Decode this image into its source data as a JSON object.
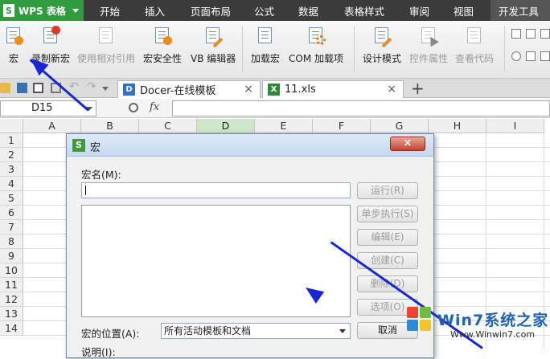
{
  "app": {
    "name": "WPS 表格",
    "logo": "S"
  },
  "menu": [
    {
      "label": "开始"
    },
    {
      "label": "插入"
    },
    {
      "label": "页面布局"
    },
    {
      "label": "公式"
    },
    {
      "label": "数据"
    },
    {
      "label": "表格样式"
    },
    {
      "label": "审阅"
    },
    {
      "label": "视图"
    },
    {
      "label": "开发工具",
      "active": true
    }
  ],
  "ribbon": [
    {
      "label": "宏",
      "icon": "macro-icon",
      "enabled": true
    },
    {
      "label": "录制新宏",
      "icon": "record-macro-icon",
      "enabled": true
    },
    {
      "label": "使用相对引用",
      "icon": "relative-reference-icon",
      "enabled": false
    },
    {
      "label": "宏安全性",
      "icon": "macro-security-icon",
      "enabled": true
    },
    {
      "label": "VB 编辑器",
      "icon": "vb-editor-icon",
      "enabled": true
    },
    {
      "label": "加载宏",
      "icon": "load-macro-icon",
      "enabled": true
    },
    {
      "label": "COM 加载项",
      "icon": "com-addin-icon",
      "enabled": true
    },
    {
      "label": "设计模式",
      "icon": "design-mode-icon",
      "enabled": true
    },
    {
      "label": "控件属性",
      "icon": "control-properties-icon",
      "enabled": false
    },
    {
      "label": "查看代码",
      "icon": "view-code-icon",
      "enabled": false
    }
  ],
  "tabs": [
    {
      "label": "Docer-在线模板",
      "icon": "docer-icon",
      "icon_text": "D",
      "close": "×"
    },
    {
      "label": "11.xls",
      "icon": "xls-file-icon",
      "icon_text": "X",
      "close": "×"
    }
  ],
  "new_tab": "+",
  "formula_bar": {
    "cell_ref": "D15",
    "fx": "fx",
    "value": ""
  },
  "columns": [
    "A",
    "B",
    "C",
    "D",
    "E",
    "F",
    "G",
    "H",
    "I"
  ],
  "selected_column": "D",
  "rows": [
    "1",
    "2",
    "3",
    "4",
    "5",
    "6",
    "7",
    "8",
    "9",
    "10",
    "11",
    "12",
    "13",
    "14"
  ],
  "dialog": {
    "title": "宏",
    "logo": "S",
    "close": "×",
    "macro_name_label": "宏名(M):",
    "macro_name_value": "",
    "buttons": [
      {
        "label": "运行(R)",
        "enabled": false
      },
      {
        "label": "单步执行(S)",
        "enabled": false
      },
      {
        "label": "编辑(E)",
        "enabled": false
      },
      {
        "label": "创建(C)",
        "enabled": false
      },
      {
        "label": "删除(D)",
        "enabled": false
      },
      {
        "label": "选项(O)",
        "enabled": false
      },
      {
        "label": "取消",
        "enabled": true
      }
    ],
    "location_label": "宏的位置(A):",
    "location_value": "所有活动模板和文档",
    "description_label": "说明(I):"
  },
  "watermark": {
    "brand": "Win7系统之家",
    "url": "Www.Winwin7.com"
  },
  "colors": {
    "accent_green": "#2f9c3e",
    "menubar": "#3b3b3b",
    "arrow": "#1726d6",
    "close_red": "#c2442d"
  }
}
